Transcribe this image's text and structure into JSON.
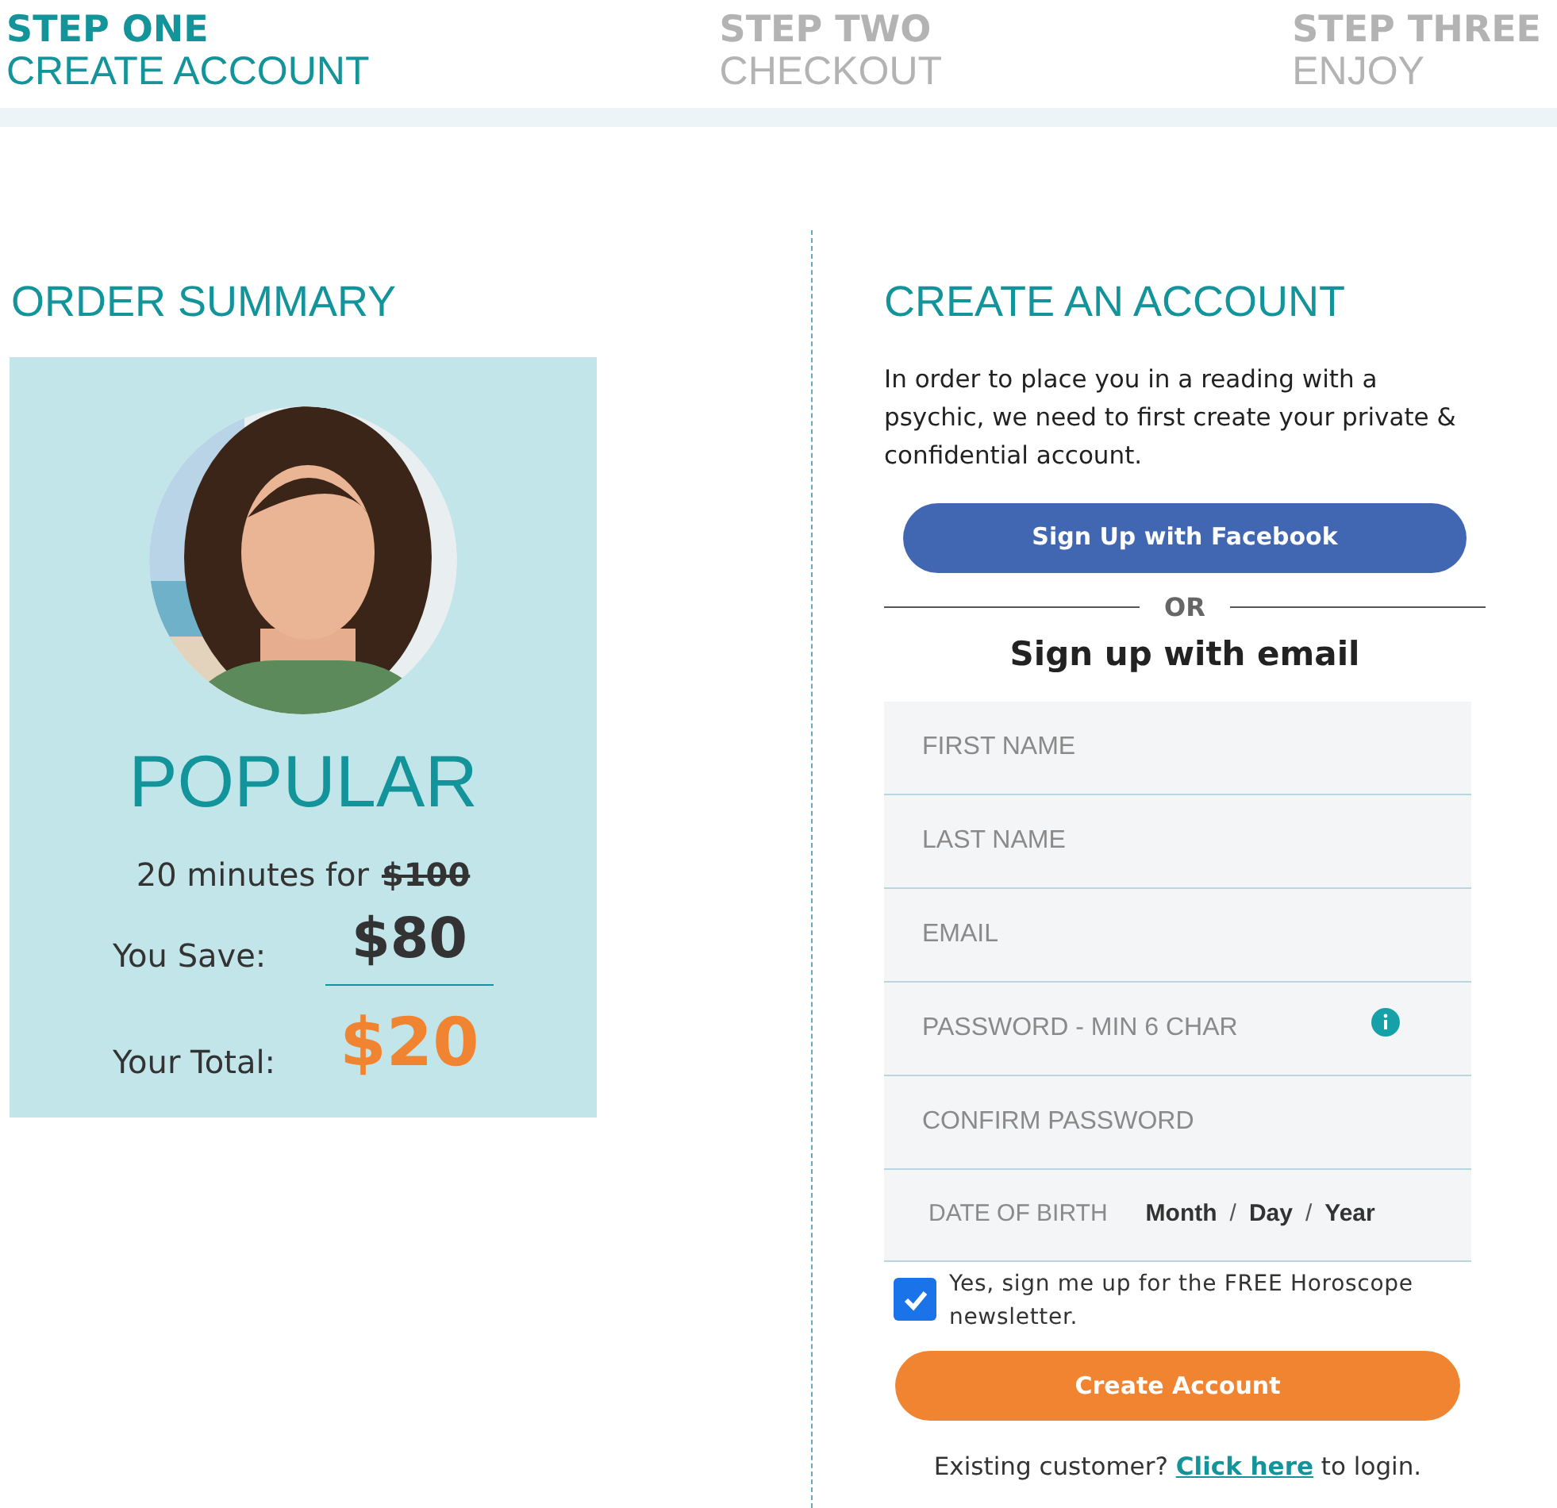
{
  "steps": [
    {
      "title": "STEP ONE",
      "subtitle": "CREATE ACCOUNT",
      "selected": true
    },
    {
      "title": "STEP TWO",
      "subtitle": "CHECKOUT",
      "selected": false
    },
    {
      "title": "STEP THREE",
      "subtitle": "ENJOY",
      "selected": false
    }
  ],
  "order_summary": {
    "heading": "ORDER SUMMARY",
    "plan": "POPULAR",
    "duration_text": "20 minutes for",
    "original_price": "$100",
    "save_label": "You Save:",
    "save_amount": "$80",
    "total_label": "Your Total:",
    "total_amount": "$20"
  },
  "account": {
    "heading": "CREATE AN ACCOUNT",
    "intro": "In order to place you in a reading with a psychic, we need to first create your private & confidential account.",
    "facebook_button": "Sign Up with Facebook",
    "divider_text": "OR",
    "email_heading": "Sign up with email",
    "fields": [
      {
        "kind": "text",
        "placeholder": "FIRST NAME"
      },
      {
        "kind": "text",
        "placeholder": "LAST NAME"
      },
      {
        "kind": "text",
        "placeholder": "EMAIL"
      },
      {
        "kind": "info",
        "placeholder": "PASSWORD - MIN 6 CHAR"
      },
      {
        "kind": "text",
        "placeholder": "CONFIRM PASSWORD"
      },
      {
        "kind": "date",
        "label": "DATE OF BIRTH",
        "parts": [
          {
            "kind": "part",
            "text": "Month"
          },
          {
            "kind": "sep",
            "text": "/"
          },
          {
            "kind": "part",
            "text": "Day"
          },
          {
            "kind": "sep",
            "text": "/"
          },
          {
            "kind": "part",
            "text": "Year"
          }
        ]
      }
    ],
    "newsletter": {
      "label": "Yes, sign me up for the FREE Horoscope newsletter.",
      "checked": true
    },
    "submit_button": "Create Account",
    "login": {
      "before": "Existing customer?",
      "link": "Click here",
      "after": "to login."
    }
  }
}
